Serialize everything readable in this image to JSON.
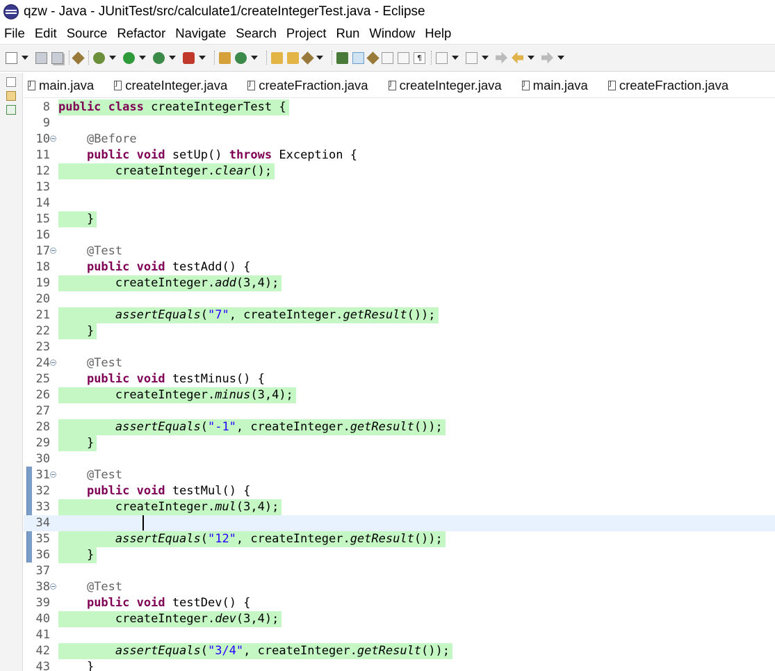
{
  "window": {
    "title": "qzw - Java - JUnitTest/src/calculate1/createIntegerTest.java - Eclipse"
  },
  "menu": [
    "File",
    "Edit",
    "Source",
    "Refactor",
    "Navigate",
    "Search",
    "Project",
    "Run",
    "Window",
    "Help"
  ],
  "tabs": [
    "main.java",
    "createInteger.java",
    "createFraction.java",
    "createInteger.java",
    "main.java",
    "createFraction.java"
  ],
  "editor": {
    "line_numbers": [
      "8",
      "9",
      "10",
      "11",
      "12",
      "13",
      "14",
      "15",
      "16",
      "17",
      "18",
      "19",
      "20",
      "21",
      "22",
      "23",
      "24",
      "25",
      "26",
      "27",
      "28",
      "29",
      "30",
      "31",
      "32",
      "33",
      "34",
      "35",
      "36",
      "37",
      "38",
      "39",
      "40",
      "41",
      "42",
      "43"
    ],
    "lines": {
      "l8": {
        "kw1": "public",
        "kw2": "class",
        "rest": " createIntegerTest {"
      },
      "l10": {
        "ann": "@Before"
      },
      "l11": {
        "kw1": "public",
        "kw2": "void",
        "mid": " setUp() ",
        "kw3": "throws",
        "rest": " Exception {"
      },
      "l12": {
        "obj": "createInteger.",
        "method": "clear",
        "rest": "();"
      },
      "l15": {
        "text": "}"
      },
      "l17": {
        "ann": "@Test"
      },
      "l18": {
        "kw1": "public",
        "kw2": "void",
        "rest": " testAdd() {"
      },
      "l19": {
        "obj": "createInteger.",
        "method": "add",
        "rest": "(3,4);"
      },
      "l21": {
        "assert": "assertEquals",
        "open": "(",
        "str": "\"7\"",
        "obj": ", createInteger.",
        "method": "getResult",
        "rest": "());"
      },
      "l22": {
        "text": "}"
      },
      "l24": {
        "ann": "@Test"
      },
      "l25": {
        "kw1": "public",
        "kw2": "void",
        "rest": " testMinus() {"
      },
      "l26": {
        "obj": "createInteger.",
        "method": "minus",
        "rest": "(3,4);"
      },
      "l28": {
        "assert": "assertEquals",
        "open": "(",
        "str": "\"-1\"",
        "obj": ", createInteger.",
        "method": "getResult",
        "rest": "());"
      },
      "l29": {
        "text": "}"
      },
      "l31": {
        "ann": "@Test"
      },
      "l32": {
        "kw1": "public",
        "kw2": "void",
        "rest": " testMul() {"
      },
      "l33": {
        "obj": "createInteger.",
        "method": "mul",
        "rest": "(3,4);"
      },
      "l35": {
        "assert": "assertEquals",
        "open": "(",
        "str": "\"12\"",
        "obj": ", createInteger.",
        "method": "getResult",
        "rest": "());"
      },
      "l36": {
        "text": "}"
      },
      "l38": {
        "ann": "@Test"
      },
      "l39": {
        "kw1": "public",
        "kw2": "void",
        "rest": " testDev() {"
      },
      "l40": {
        "obj": "createInteger.",
        "method": "dev",
        "rest": "(3,4);"
      },
      "l42": {
        "assert": "assertEquals",
        "open": "(",
        "str": "\"3/4\"",
        "obj": ", createInteger.",
        "method": "getResult",
        "rest": "());"
      },
      "l43": {
        "text": "}"
      }
    }
  },
  "colors": {
    "keyword": "#7f0055",
    "string": "#2a00ff",
    "annotation": "#646464",
    "coverage": "#c4f7c4",
    "current_line": "#e8f2fe"
  }
}
